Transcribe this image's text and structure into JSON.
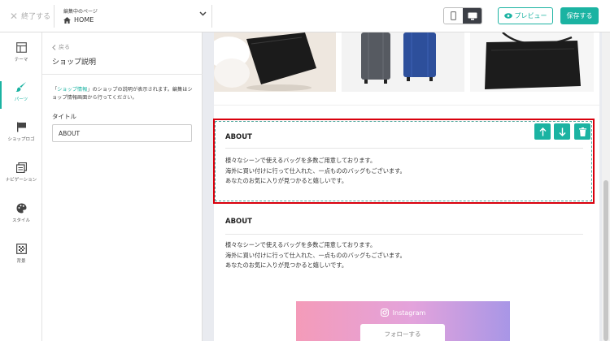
{
  "topbar": {
    "close_label": "終了する",
    "page_select_caption": "編集中のページ",
    "page_select_value": "HOME",
    "preview_label": "プレビュー",
    "save_label": "保存する"
  },
  "rail": {
    "items": [
      {
        "label": "テーマ",
        "icon": "layout-icon"
      },
      {
        "label": "パーツ",
        "icon": "brush-icon"
      },
      {
        "label": "ショップロゴ",
        "icon": "flag-icon"
      },
      {
        "label": "ナビゲーション",
        "icon": "navigation-icon"
      },
      {
        "label": "スタイル",
        "icon": "palette-icon"
      },
      {
        "label": "背景",
        "icon": "background-icon"
      }
    ]
  },
  "panel": {
    "back_label": "戻る",
    "title": "ショップ説明",
    "desc_prefix": "「",
    "desc_link": "ショップ情報",
    "desc_suffix": "」のショップの説明が表示されます。編集はショップ情報画面から行ってください。",
    "field_label": "タイトル",
    "field_value": "ABOUT"
  },
  "about_selected": {
    "title": "ABOUT",
    "lines": [
      "様々なシーンで使えるバッグを多数ご用意しております。",
      "海外に買い付けに行って仕入れた、一点もののバッグもございます。",
      "あなたのお気に入りが見つかると嬉しいです。"
    ]
  },
  "about_second": {
    "title": "ABOUT",
    "lines": [
      "様々なシーンで使えるバッグを多数ご用意しております。",
      "海外に買い付けに行って仕入れた、一点もののバッグもございます。",
      "あなたのお気に入りが見つかると嬉しいです。"
    ]
  },
  "instagram": {
    "label": "Instagram",
    "follow_label": "フォローする"
  },
  "colors": {
    "accent": "#1bb3a2",
    "selection": "#d9000d"
  }
}
